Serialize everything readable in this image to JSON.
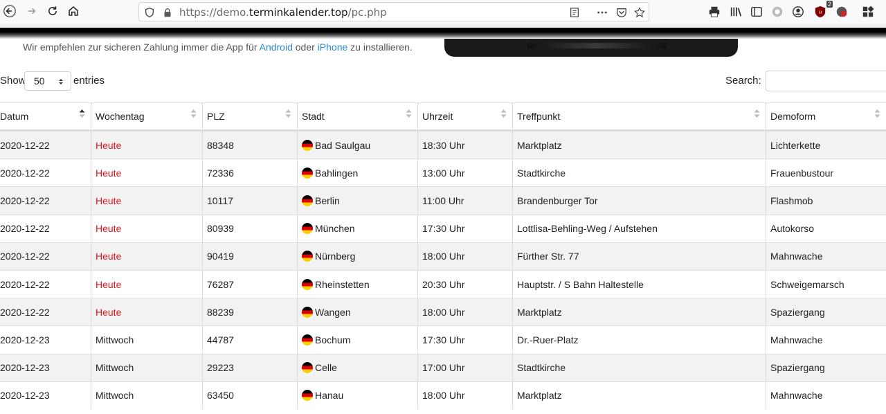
{
  "browser": {
    "url_prefix": "https://demo.",
    "url_domain": "terminkalender.top",
    "url_path": "/pc.php",
    "ublock_badge": "2"
  },
  "page": {
    "notice_before": "Wir empfehlen zur sicheren Zahlung immer die App für ",
    "notice_android": "Android",
    "notice_mid": " oder ",
    "notice_iphone": "iPhone",
    "notice_after": " zu installieren."
  },
  "controls": {
    "show_label": "Show",
    "length_value": "50",
    "entries_label": "entries",
    "search_label": "Search:",
    "search_value": ""
  },
  "table": {
    "columns": [
      "Datum",
      "Wochentag",
      "PLZ",
      "Stadt",
      "Uhrzeit",
      "Treffpunkt",
      "Demoform"
    ],
    "rows": [
      {
        "datum": "2020-12-22",
        "wochentag": "Heute",
        "plz": "88348",
        "stadt": "Bad Saulgau",
        "uhrzeit": "18:30 Uhr",
        "treffpunkt": "Marktplatz",
        "demoform": "Lichterkette"
      },
      {
        "datum": "2020-12-22",
        "wochentag": "Heute",
        "plz": "72336",
        "stadt": "Bahlingen",
        "uhrzeit": "13:00 Uhr",
        "treffpunkt": "Stadtkirche",
        "demoform": "Frauenbustour"
      },
      {
        "datum": "2020-12-22",
        "wochentag": "Heute",
        "plz": "10117",
        "stadt": "Berlin",
        "uhrzeit": "11:00 Uhr",
        "treffpunkt": "Brandenburger Tor",
        "demoform": "Flashmob"
      },
      {
        "datum": "2020-12-22",
        "wochentag": "Heute",
        "plz": "80939",
        "stadt": "München",
        "uhrzeit": "17:30 Uhr",
        "treffpunkt": "Lottlisa-Behling-Weg / Aufstehen",
        "demoform": "Autokorso"
      },
      {
        "datum": "2020-12-22",
        "wochentag": "Heute",
        "plz": "90419",
        "stadt": "Nürnberg",
        "uhrzeit": "18:00 Uhr",
        "treffpunkt": "Fürther Str. 77",
        "demoform": "Mahnwache"
      },
      {
        "datum": "2020-12-22",
        "wochentag": "Heute",
        "plz": "76287",
        "stadt": "Rheinstetten",
        "uhrzeit": "20:30 Uhr",
        "treffpunkt": "Hauptstr. / S Bahn Haltestelle",
        "demoform": "Schweigemarsch"
      },
      {
        "datum": "2020-12-22",
        "wochentag": "Heute",
        "plz": "88239",
        "stadt": "Wangen",
        "uhrzeit": "18:00 Uhr",
        "treffpunkt": "Marktplatz",
        "demoform": "Spaziergang"
      },
      {
        "datum": "2020-12-23",
        "wochentag": "Mittwoch",
        "plz": "44787",
        "stadt": "Bochum",
        "uhrzeit": "17:30 Uhr",
        "treffpunkt": "Dr.-Ruer-Platz",
        "demoform": "Mahnwache"
      },
      {
        "datum": "2020-12-23",
        "wochentag": "Mittwoch",
        "plz": "29223",
        "stadt": "Celle",
        "uhrzeit": "17:00 Uhr",
        "treffpunkt": "Stadtkirche",
        "demoform": "Spaziergang"
      },
      {
        "datum": "2020-12-23",
        "wochentag": "Mittwoch",
        "plz": "63450",
        "stadt": "Hanau",
        "uhrzeit": "18:00 Uhr",
        "treffpunkt": "Marktplatz",
        "demoform": "Mahnwache"
      }
    ]
  },
  "colors": {
    "today": "#e0141e",
    "link": "#2a8ad8",
    "stripe": "#f2f2f2"
  }
}
